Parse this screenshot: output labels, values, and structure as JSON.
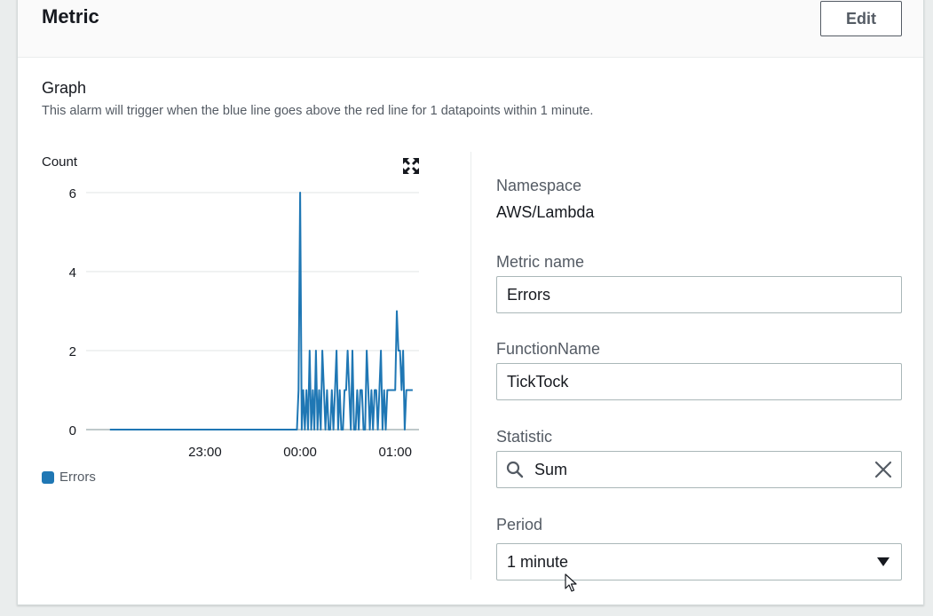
{
  "panel": {
    "title": "Metric",
    "edit_label": "Edit"
  },
  "graph": {
    "title": "Graph",
    "description": "This alarm will trigger when the blue line goes above the red line for 1 datapoints within 1 minute."
  },
  "chart_data": {
    "type": "line",
    "title": "",
    "ylabel": "Count",
    "xlabel": "",
    "ylim": [
      0,
      6
    ],
    "y_ticks": [
      "6",
      "4",
      "2",
      "0"
    ],
    "x_ticks": [
      "23:00",
      "00:00",
      "01:00"
    ],
    "grid": true,
    "legend_position": "bottom-left",
    "series": [
      {
        "name": "Errors",
        "color": "#1f77b4",
        "x_minutes_from_midnight": [
          -120,
          -2,
          -1,
          0,
          1,
          2,
          3,
          4,
          5,
          6,
          7,
          8,
          9,
          10,
          11,
          12,
          13,
          14,
          15,
          16,
          17,
          18,
          19,
          20,
          21,
          22,
          23,
          24,
          25,
          26,
          27,
          28,
          29,
          30,
          31,
          32,
          33,
          34,
          35,
          36,
          37,
          38,
          39,
          40,
          41,
          42,
          43,
          44,
          45,
          46,
          47,
          48,
          49,
          50,
          51,
          52,
          53,
          54,
          55,
          56,
          57,
          58,
          59,
          60,
          61,
          62,
          63,
          64,
          65,
          66,
          67,
          68,
          69,
          70,
          71
        ],
        "values": [
          0,
          0,
          1,
          6,
          0,
          1,
          0,
          1,
          0,
          2,
          0,
          1,
          0,
          2,
          0,
          1,
          0,
          2,
          1,
          0,
          1,
          0,
          0,
          1,
          0,
          1,
          2,
          0,
          1,
          0,
          0,
          1,
          1,
          2,
          1,
          0,
          2,
          0,
          0,
          1,
          0,
          1,
          1,
          0,
          0,
          2,
          1,
          0,
          1,
          0,
          1,
          1,
          0,
          1,
          2,
          0,
          1,
          0,
          1,
          1,
          1,
          1,
          1,
          1,
          3,
          2,
          2,
          1,
          2,
          0,
          1,
          1,
          1,
          1,
          1
        ]
      }
    ]
  },
  "icons": {
    "expand": "expand-icon",
    "search": "search-icon",
    "clear": "close-icon",
    "dropdown": "caret-down-icon"
  },
  "details": {
    "namespace_label": "Namespace",
    "namespace_value": "AWS/Lambda",
    "metric_name_label": "Metric name",
    "metric_name_value": "Errors",
    "function_name_label": "FunctionName",
    "function_name_value": "TickTock",
    "statistic_label": "Statistic",
    "statistic_value": "Sum",
    "period_label": "Period",
    "period_value": "1 minute"
  }
}
